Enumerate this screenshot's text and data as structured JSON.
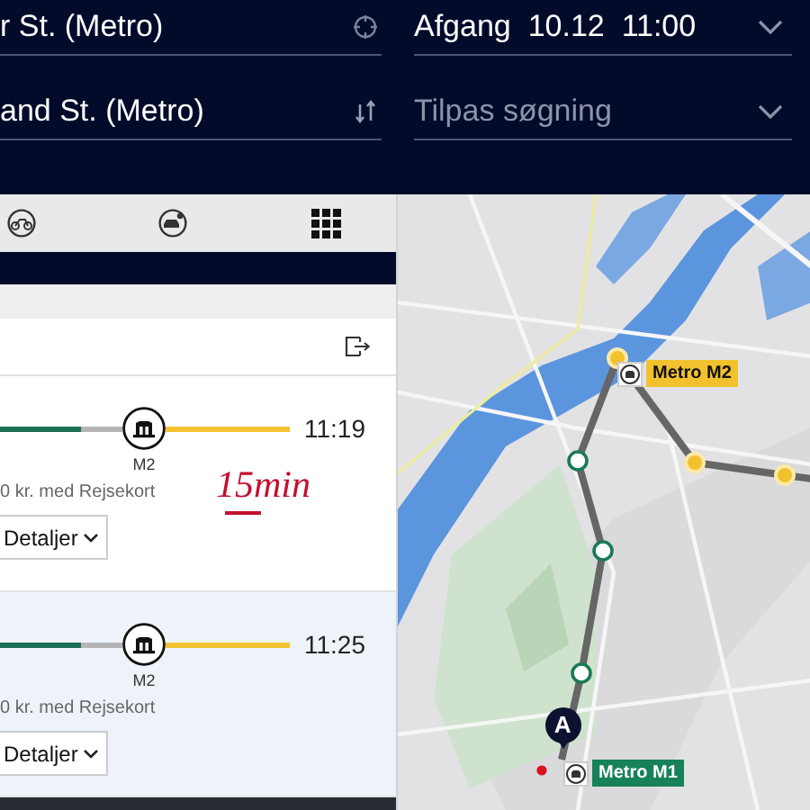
{
  "search": {
    "from": "r St. (Metro)",
    "to": "and St. (Metro)",
    "departure": "Afgang  10.12  11:00",
    "options_placeholder": "Tilpas søgning"
  },
  "journeys": [
    {
      "arrival": "11:19",
      "line": "M2",
      "price": "0 kr. med Rejsekort",
      "details": "Detaljer",
      "selected": false
    },
    {
      "arrival": "11:25",
      "line": "M2",
      "price": "0 kr. med Rejsekort",
      "details": "Detaljer",
      "selected": true
    }
  ],
  "annotation": "15min",
  "map": {
    "kind": "picture",
    "pin": "A",
    "labels": [
      {
        "text": "Metro M2",
        "color": "#f2c12e"
      },
      {
        "text": "Metro M1",
        "color": "#17815a"
      }
    ]
  }
}
